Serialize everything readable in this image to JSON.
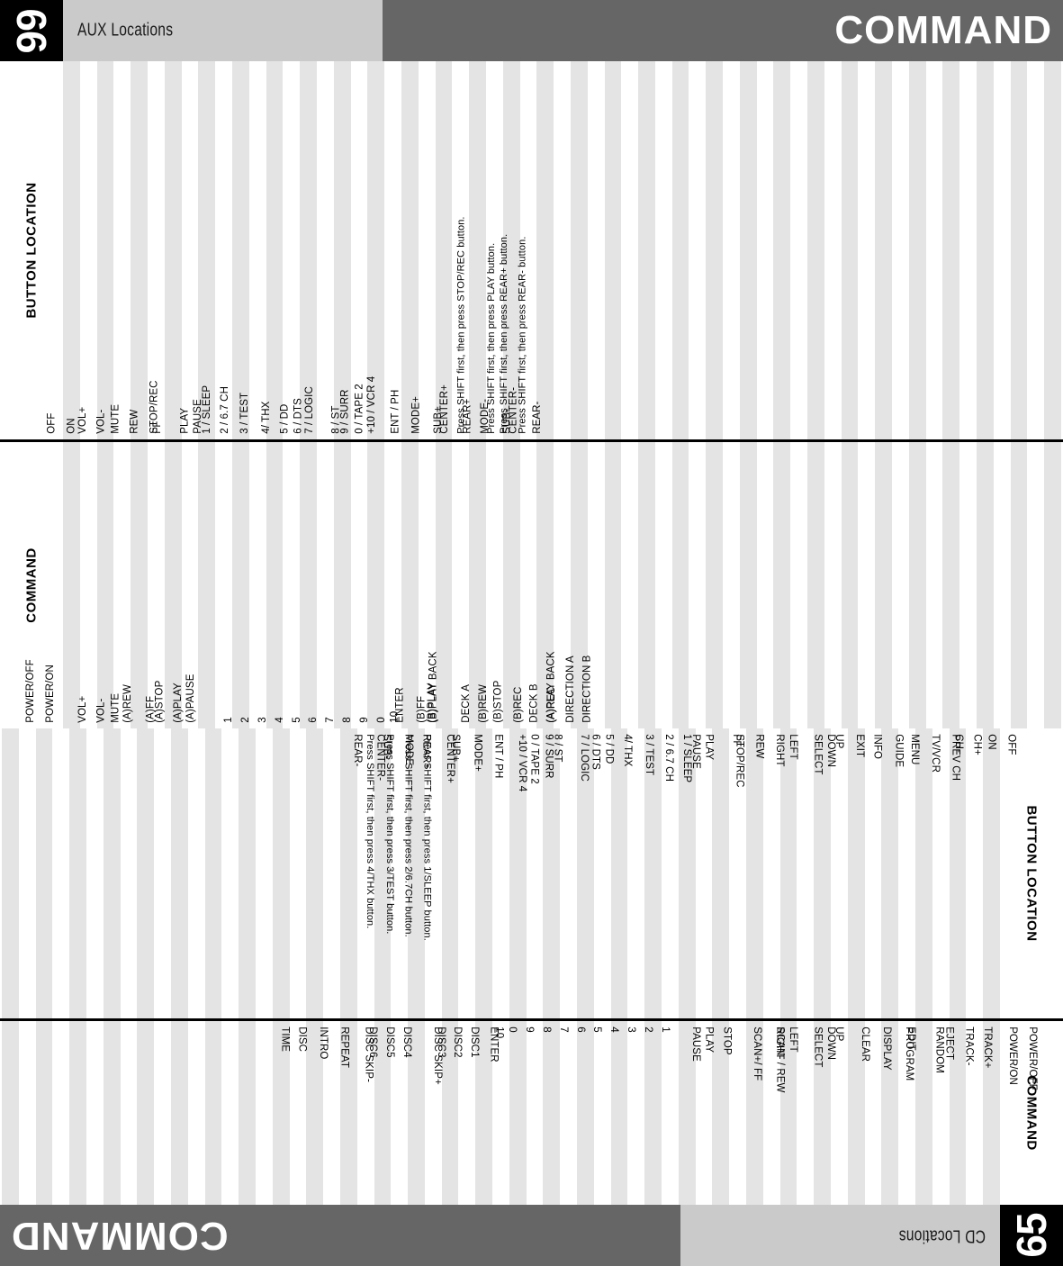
{
  "pages": {
    "right": {
      "number": "66",
      "chapter": "AUX Locations",
      "band_title": "COMMAND"
    },
    "left": {
      "number": "65",
      "chapter": "CD Locations",
      "band_title": "COMMAND"
    }
  },
  "column_titles": {
    "command": "COMMAND",
    "button_location": "BUTTON LOCATION"
  },
  "tables": {
    "aux_button_location": {
      "title": "BUTTON LOCATION",
      "rows": [
        "OFF",
        "ON",
        "VOL+",
        "VOL-",
        "MUTE",
        "REW",
        "FF",
        "STOP/REC",
        "PLAY",
        "PAUSE",
        "1 / SLEEP",
        "2 / 6.7 CH",
        "3 / TEST",
        "4/ THX",
        "5 / DD",
        "6 / DTS",
        "7 / LOGIC",
        "8 / ST",
        "9 / SURR",
        "0 / TAPE 2",
        "+10 / VCR 4",
        "ENT / PH",
        "MODE+",
        "SUB+",
        "CENTER+",
        "REAR+",
        "MODE-",
        "SUB-",
        "CENTER-",
        "REAR-",
        "Press SHIFT first, then press STOP/REC button.",
        "Press SHIFT first, then press PLAY button.",
        "Press SHIFT first, then press REAR+ button.",
        "Press SHIFT first, then press REAR- button."
      ]
    },
    "aux_command": {
      "title": "COMMAND",
      "rows": [
        "POWER/OFF",
        "POWER/ON",
        "VOL+",
        "VOL-",
        "MUTE",
        "(A)REW",
        "(A)FF",
        "(A)STOP",
        "(A)PLAY",
        "(A)PAUSE",
        "1",
        "2",
        "3",
        "4",
        "5",
        "6",
        "7",
        "8",
        "9",
        "0",
        "10",
        "ENTER",
        "(B)FF",
        "(B)PLAY",
        "(B)PLAY BACK",
        "DECK A",
        "(B)REW",
        "(B)STOP",
        "(B)REC",
        "DECK B",
        "(A)REC",
        "(A)PLAY BACK",
        "DIRECTION A",
        "DIRECTION B"
      ]
    },
    "cd_button_location": {
      "title": "BUTTON LOCATION",
      "rows": [
        "OFF",
        "ON",
        "CH+",
        "CH-",
        "PREV CH",
        "TV/VCR",
        "MENU",
        "GUIDE",
        "INFO",
        "EXIT",
        "UP",
        "DOWN",
        "SELECT",
        "LEFT",
        "RIGHT",
        "REW",
        "FF",
        "STOP/REC",
        "PLAY",
        "PAUSE",
        "1 / SLEEP",
        "2 / 6.7 CH",
        "3 / TEST",
        "4/ THX",
        "5 / DD",
        "6 / DTS",
        "7 / LOGIC",
        "8 / ST",
        "9 / SURR",
        "0 / TAPE 2",
        "+10 / VCR 4",
        "ENT / PH",
        "MODE+",
        "SUB+",
        "CENTER+",
        "REAR+",
        "MODE-",
        "SUB-",
        "CENTER-",
        "REAR-",
        "Press SHIFT first, then press 1/SLEEP button.",
        "Press SHIFT first, then press 2/6.7CH button.",
        "Press SHIFT first, then press 3/TEST button.",
        "Press SHIFT first, then press 4/THX button."
      ]
    },
    "cd_command": {
      "title": "COMMAND",
      "rows": [
        "POWER/OFF",
        "POWER/ON",
        "TRACK+",
        "TRACK-",
        "EJECT",
        "RANDOM",
        "EDIT",
        "PROGRAM",
        "DISPLAY",
        "CLEAR",
        "UP",
        "DOWN",
        "SELECT",
        "LEFT",
        "RIGHT",
        "SCAN- / REW",
        "SCAN+/ FF",
        "STOP",
        "PLAY",
        "PAUSE",
        "1",
        "2",
        "3",
        "4",
        "5",
        "6",
        "7",
        "8",
        "9",
        "0",
        "10",
        "ENTER",
        "DISC1",
        "DISC2",
        "DISC3",
        "DISC SKIP+",
        "DISC4",
        "DISC5",
        "DISC6",
        "DISC SKIP-",
        "REPEAT",
        "INTRO",
        "DISC",
        "TIME"
      ]
    }
  },
  "colors": {
    "band": "#666666",
    "chapter_tab": "#cacaca",
    "stripe_alt": "#e4e4e4",
    "page_block": "#000000"
  }
}
